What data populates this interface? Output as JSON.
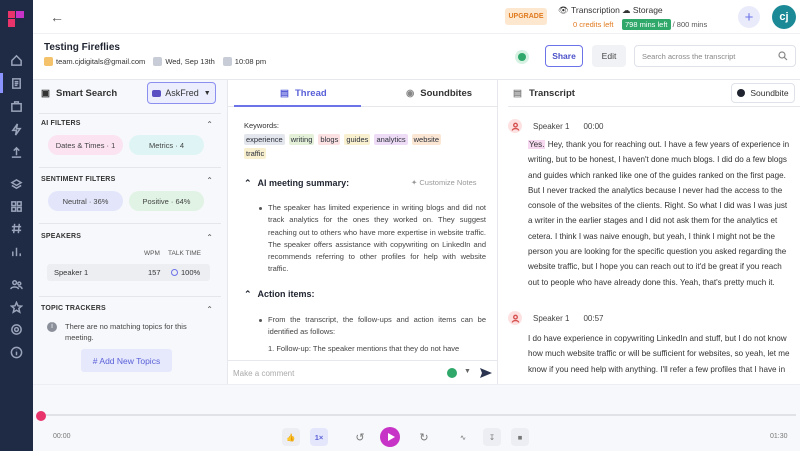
{
  "header": {
    "upgrade_label": "UPGRADE",
    "transcription_label": "Transcription",
    "transcription_credits": "0 credits left",
    "storage_label": "Storage",
    "storage_left": "798 mins left",
    "storage_total": "/ 800 mins",
    "avatar_initials": "cj"
  },
  "meeting": {
    "title": "Testing Fireflies",
    "email": "team.cjdigitals@gmail.com",
    "date": "Wed, Sep 13th",
    "time": "10:08 pm",
    "share_label": "Share",
    "edit_label": "Edit",
    "search_placeholder": "Search across the transcript"
  },
  "left": {
    "smart_search": "Smart Search",
    "askfred": "AskFred",
    "ai_filters_title": "AI FILTERS",
    "ai_filters": [
      "Dates & Times · 1",
      "Metrics · 4"
    ],
    "sentiment_title": "SENTIMENT FILTERS",
    "sentiment": [
      "Neutral · 36%",
      "Positive · 64%"
    ],
    "speakers_title": "SPEAKERS",
    "wpm_label": "WPM",
    "talk_label": "TALK TIME",
    "speaker_name": "Speaker 1",
    "speaker_wpm": "157",
    "speaker_talk": "100%",
    "topic_title": "TOPIC TRACKERS",
    "topic_empty": "There are no matching topics for this meeting.",
    "add_topics": "# Add New Topics"
  },
  "middle": {
    "tab_thread": "Thread",
    "tab_soundbites": "Soundbites",
    "keywords_label": "Keywords:",
    "keywords": [
      "experience",
      "writing",
      "blogs",
      "guides",
      "analytics",
      "website",
      "traffic"
    ],
    "keyword_colors": [
      "#e3e6ec",
      "#e4f1d8",
      "#fbe1e1",
      "#f8f0cf",
      "#eedcf6",
      "#fbe6d3",
      "#f8f0cf"
    ],
    "summary_title": "AI meeting summary:",
    "customize_notes": "Customize Notes",
    "summary_bullet": "The speaker has limited experience in writing blogs and did not track analytics for the ones they worked on. They suggest reaching out to others who have more expertise in website traffic. The speaker offers assistance with copywriting on LinkedIn and recommends referring to other profiles for help with website traffic.",
    "action_title": "Action items:",
    "action_bullet": "From the transcript, the follow-ups and action items can be identified as follows:",
    "action_sub": "1. Follow-up: The speaker mentions that they do not have",
    "comment_placeholder": "Make a comment"
  },
  "transcript": {
    "title": "Transcript",
    "soundbite_btn": "Soundbite",
    "entries": [
      {
        "speaker": "Speaker 1",
        "time": "00:00",
        "highlight": "Yes.",
        "text": " Hey, thank you for reaching out. I have a few years of experience in writing, but to be honest, I haven't done much blogs. I did do a few blogs and guides which ranked like one of the guides ranked on the first page. But I never tracked the analytics because I never had the access to the console of the websites of the clients. Right. So what I did was I was just a writer in the earlier stages and I did not ask them for the analytics et cetera. I think I was naive enough, but yeah, I think I might not be the person you are looking for the specific question you asked regarding the website traffic, but I hope you can reach out to it'd be great if you reach out to people who have already done this. Yeah, that's pretty much it."
      },
      {
        "speaker": "Speaker 1",
        "time": "00:57",
        "text": "I do have experience in copywriting LinkedIn and stuff, but I do not know how much website traffic or will be sufficient for websites, so yeah, let me know if you need help with anything. I'll refer a few profiles that I have in"
      }
    ]
  },
  "player": {
    "current_time": "00:00",
    "total_time": "01:30",
    "speed": "1×",
    "progress": 0.0
  },
  "colors": {
    "accent": "#6c72e8",
    "rail": "#1f2a44",
    "play": "#c633c6",
    "scrubber": "#e8336b"
  }
}
